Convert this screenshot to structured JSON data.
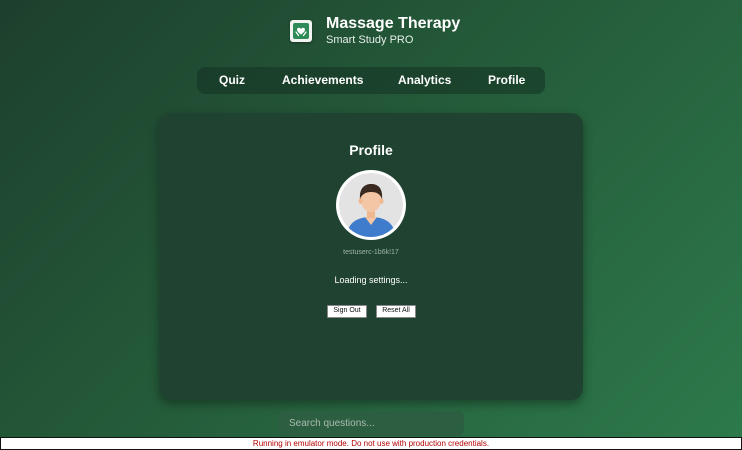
{
  "app": {
    "title": "Massage Therapy",
    "subtitle": "Smart Study PRO",
    "logo_icon": "hands-heart-icon",
    "accent_color": "#2d7a4c"
  },
  "nav": {
    "tabs": [
      {
        "label": "Quiz"
      },
      {
        "label": "Achievements"
      },
      {
        "label": "Analytics"
      },
      {
        "label": "Profile"
      }
    ]
  },
  "profile": {
    "title": "Profile",
    "avatar_icon": "user-avatar-icon",
    "user_id": "testuserc-1b6k!17",
    "status_text": "Loading settings...",
    "sign_out_label": "Sign Out",
    "reset_label": "Reset All"
  },
  "search": {
    "placeholder": "Search questions...",
    "value": ""
  },
  "banner": {
    "text": "Running in emulator mode. Do not use with production credentials.",
    "color": "#b30000"
  }
}
